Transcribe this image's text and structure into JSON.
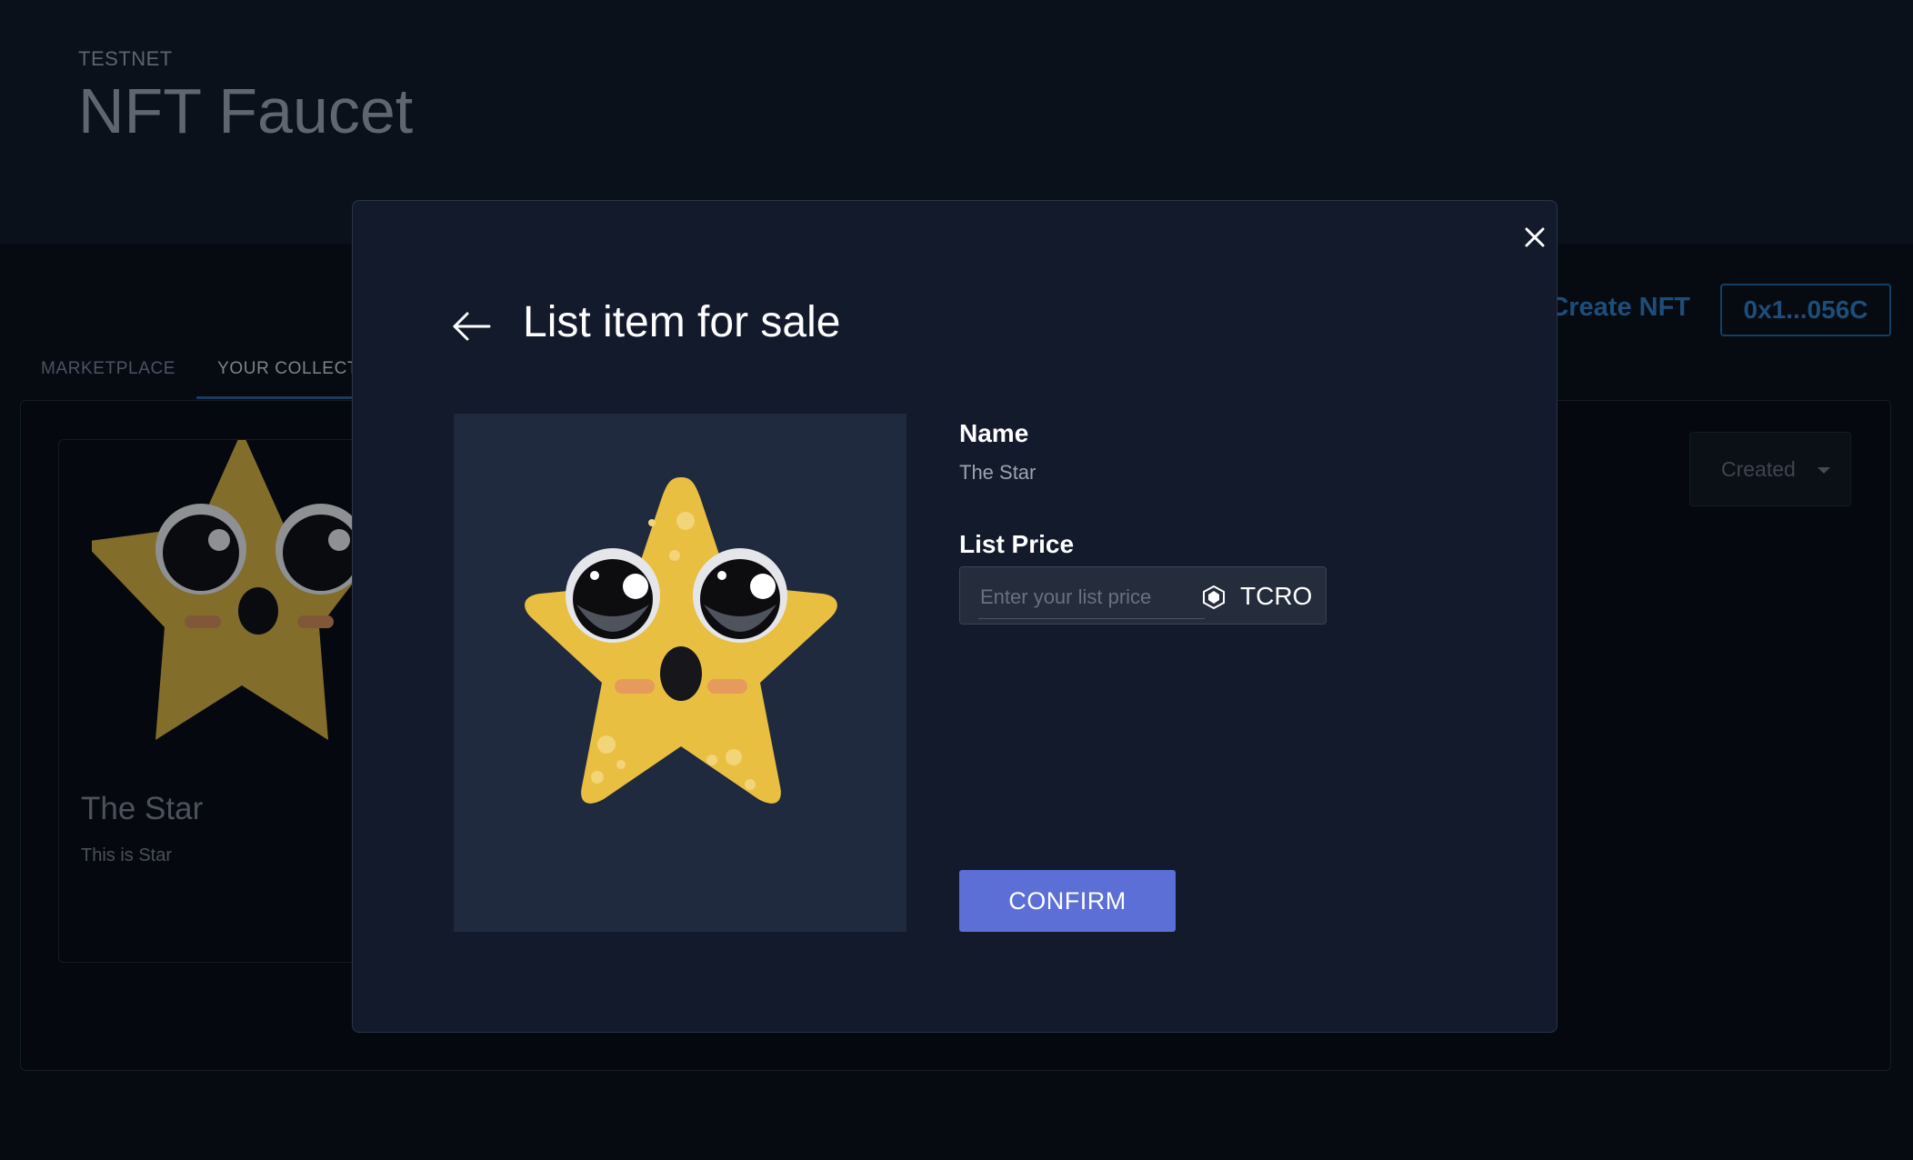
{
  "header": {
    "network": "TESTNET",
    "title": "NFT Faucet"
  },
  "nav": {
    "create_nft": "Create NFT",
    "wallet": "0x1...056C"
  },
  "tabs": [
    {
      "label": "MARKETPLACE",
      "active": false
    },
    {
      "label": "YOUR COLLECT",
      "active": true
    }
  ],
  "collection": {
    "filter": {
      "selected": "Created"
    },
    "cards": [
      {
        "title": "The Star",
        "description": "This is Star",
        "image": "star-character"
      }
    ]
  },
  "modal": {
    "title": "List item for sale",
    "name_label": "Name",
    "name_value": "The Star",
    "price_label": "List Price",
    "price_value": "",
    "price_placeholder": "Enter your list price",
    "currency": "TCRO",
    "confirm_label": "CONFIRM",
    "icons": {
      "close": "close-icon",
      "back": "arrow-left-icon",
      "currency": "cro-icon"
    }
  },
  "colors": {
    "accent": "#5b6fd6",
    "modal_bg": "#121a2c",
    "star": "#e9bf42",
    "page_bg": "#060b12"
  }
}
